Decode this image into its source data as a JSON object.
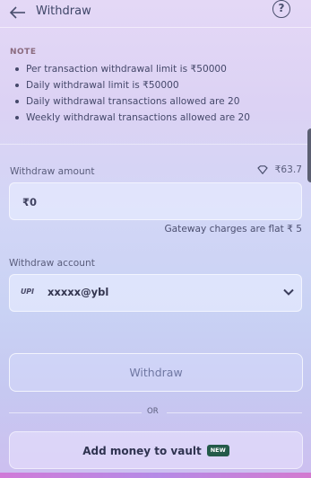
{
  "header": {
    "title": "Withdraw",
    "help_label": "?"
  },
  "note": {
    "title": "NOTE",
    "items": [
      "Per transaction withdrawal limit is ₹50000",
      "Daily withdrawal limit is ₹50000",
      "Daily withdrawal transactions allowed are 20",
      "Weekly withdrawal transactions allowed are 20"
    ]
  },
  "withdraw_amount": {
    "label": "Withdraw amount",
    "balance": "₹63.7",
    "value": "₹0",
    "gateway_note": "Gateway charges are flat ₹ 5"
  },
  "withdraw_account": {
    "label": "Withdraw account",
    "upi_logo_text": "UPI",
    "value": "xxxxx@ybl"
  },
  "buttons": {
    "withdraw": "Withdraw",
    "or": "OR",
    "add_money": "Add money to vault",
    "new_badge": "NEW"
  },
  "icons": {
    "back": "back-arrow-icon",
    "help": "help-circle-icon",
    "balance": "gem-icon",
    "dropdown": "chevron-down-icon"
  },
  "colors": {
    "badge_bg": "#245a49",
    "text_primary": "#3a3c5a"
  }
}
